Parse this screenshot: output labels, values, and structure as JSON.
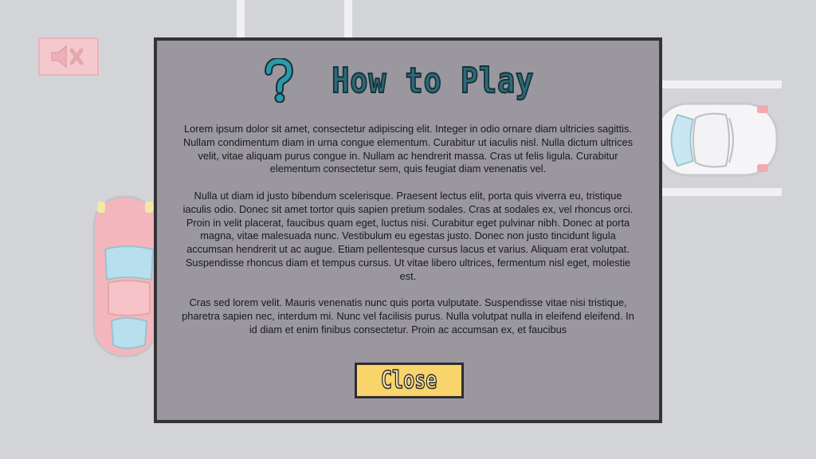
{
  "dialog": {
    "title": "How to Play",
    "paragraphs": [
      "Lorem ipsum dolor sit amet, consectetur adipiscing elit. Integer in odio ornare diam ultricies sagittis. Nullam condimentum diam in urna congue elementum. Curabitur ut iaculis nisl. Nulla dictum ultrices velit, vitae aliquam purus congue in. Nullam ac hendrerit massa. Cras ut felis ligula. Curabitur elementum consectetur sem, quis feugiat diam venenatis vel.",
      "Nulla ut diam id justo bibendum scelerisque. Praesent lectus elit, porta quis viverra eu, tristique iaculis odio. Donec sit amet tortor quis sapien pretium sodales. Cras at sodales ex, vel rhoncus orci. Proin in velit placerat, faucibus quam eget, luctus nisi. Curabitur eget pulvinar nibh. Donec at porta magna, vitae malesuada nunc. Vestibulum eu egestas justo. Donec non justo tincidunt ligula accumsan hendrerit ut ac augue. Etiam pellentesque cursus lacus et varius. Aliquam erat volutpat. Suspendisse rhoncus diam et tempus cursus. Ut vitae libero ultrices, fermentum nisl eget, molestie est.",
      "Cras sed lorem velit. Mauris venenatis nunc quis porta vulputate. Suspendisse vitae nisi tristique, pharetra sapien nec, interdum mi. Nunc vel facilisis purus. Nulla volutpat nulla in eleifend eleifend. In id diam et enim finibus consectetur. Proin ac accumsan ex, et faucibus"
    ],
    "close_label": "Close"
  },
  "icons": {
    "title_icon": "question-mark-icon",
    "mute_icon": "speaker-muted-icon"
  },
  "colors": {
    "background": "#d3d4d8",
    "dialog_bg": "#9a979f",
    "dialog_border": "#333236",
    "title": "#2d6a78",
    "close_button": "#f9d46a",
    "mute_button": "#f4c9cd",
    "car_white": "#f5f5f7",
    "car_red": "#f4b6bd"
  }
}
